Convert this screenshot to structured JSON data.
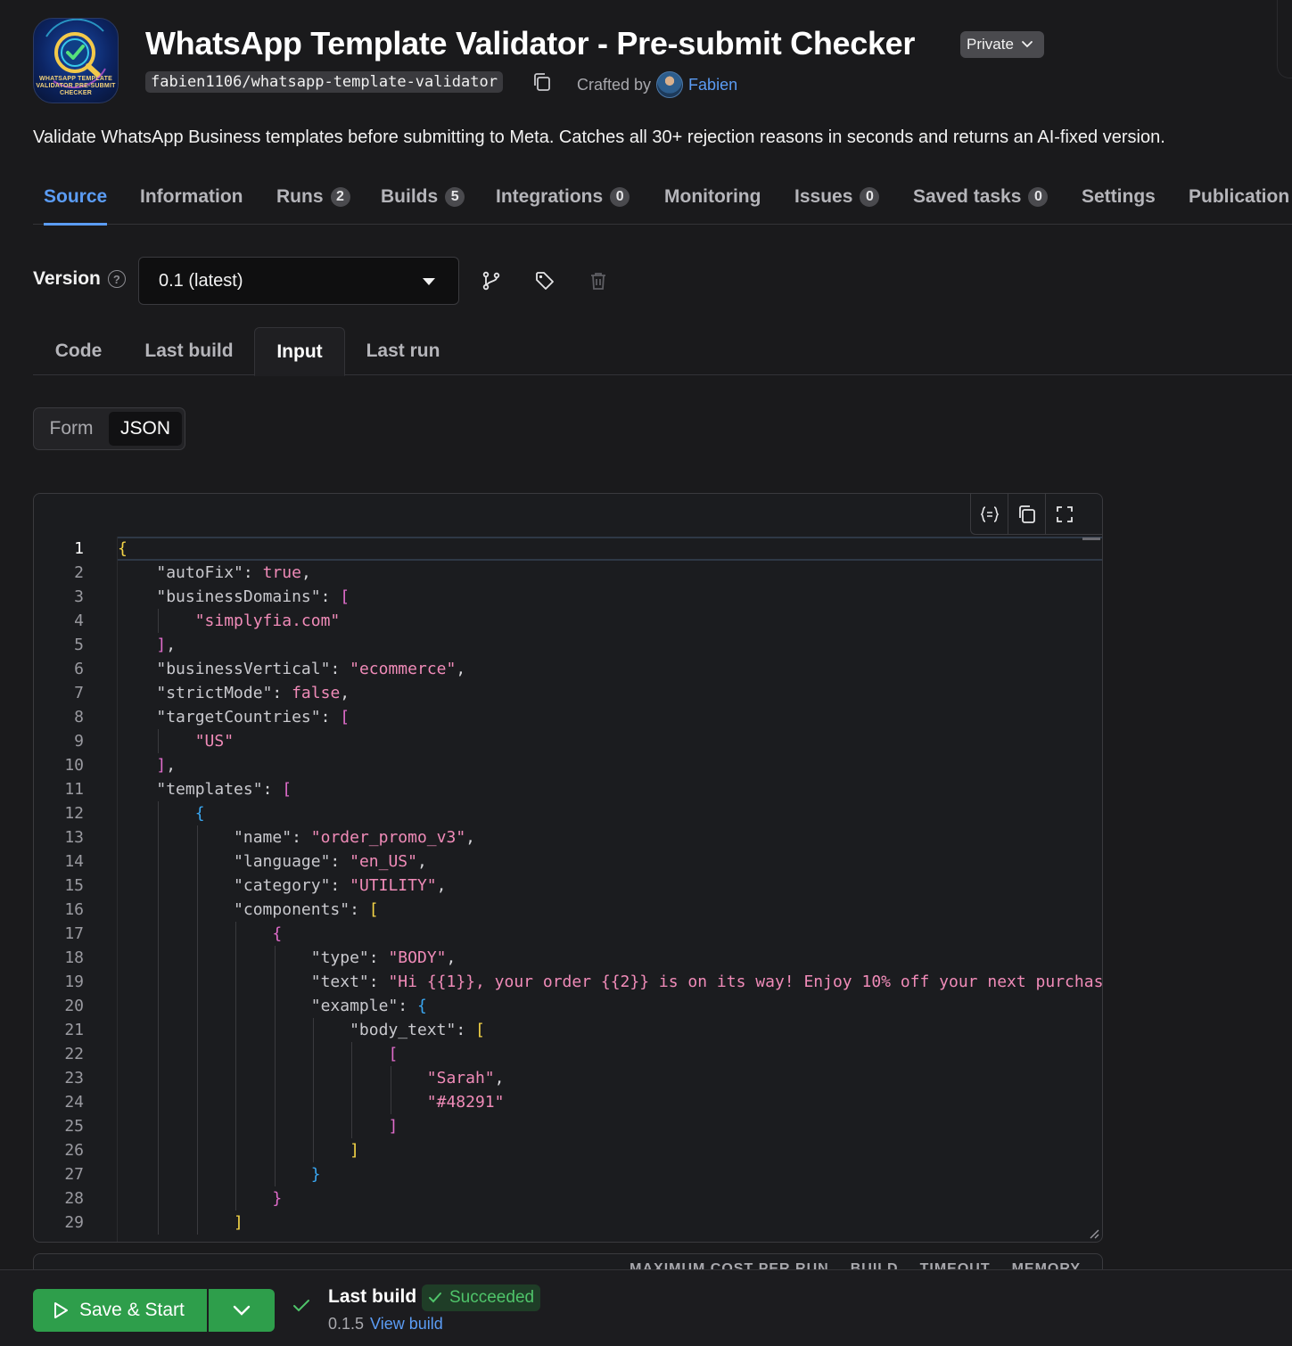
{
  "actor": {
    "logo_text": "WHATSAPP TEMPLATE VALIDATOR PRE-SUBMIT CHECKER",
    "title": "WhatsApp Template Validator - Pre-submit Checker",
    "visibility": "Private",
    "slug": "fabien1106/whatsapp-template-validator",
    "crafted_by_label": "Crafted by",
    "author": "Fabien",
    "description": "Validate WhatsApp Business templates before submitting to Meta. Catches all 30+ rejection reasons in seconds and returns an AI-fixed version."
  },
  "tabs": [
    {
      "label": "Source",
      "count": null
    },
    {
      "label": "Information",
      "count": null
    },
    {
      "label": "Runs",
      "count": "2"
    },
    {
      "label": "Builds",
      "count": "5"
    },
    {
      "label": "Integrations",
      "count": "0"
    },
    {
      "label": "Monitoring",
      "count": null
    },
    {
      "label": "Issues",
      "count": "0"
    },
    {
      "label": "Saved tasks",
      "count": "0"
    },
    {
      "label": "Settings",
      "count": null
    },
    {
      "label": "Publication",
      "count": null
    }
  ],
  "active_tab": "Source",
  "version": {
    "label": "Version",
    "help_icon": "?",
    "selected": "0.1 (latest)"
  },
  "subtabs": [
    "Code",
    "Last build",
    "Input",
    "Last run"
  ],
  "active_subtab": "Input",
  "input_mode": {
    "options": [
      "Form",
      "JSON"
    ],
    "selected": "JSON"
  },
  "editor": {
    "line_numbers": [
      "1",
      "2",
      "3",
      "4",
      "5",
      "6",
      "7",
      "8",
      "9",
      "10",
      "11",
      "12",
      "13",
      "14",
      "15",
      "16",
      "17",
      "18",
      "19",
      "20",
      "21",
      "22",
      "23",
      "24",
      "25",
      "26",
      "27",
      "28",
      "29"
    ],
    "lines": [
      [
        [
          "{",
          "b1"
        ]
      ],
      [
        [
          "    ",
          ""
        ],
        [
          "\"autoFix\"",
          "k"
        ],
        [
          ": ",
          ""
        ],
        [
          "true",
          "lit"
        ],
        [
          ",",
          ""
        ]
      ],
      [
        [
          "    ",
          ""
        ],
        [
          "\"businessDomains\"",
          "k"
        ],
        [
          ": ",
          ""
        ],
        [
          "[",
          "b2"
        ]
      ],
      [
        [
          "        ",
          ""
        ],
        [
          "\"simplyfia.com\"",
          "s"
        ]
      ],
      [
        [
          "    ",
          ""
        ],
        [
          "]",
          "b2"
        ],
        [
          ",",
          ""
        ]
      ],
      [
        [
          "    ",
          ""
        ],
        [
          "\"businessVertical\"",
          "k"
        ],
        [
          ": ",
          ""
        ],
        [
          "\"ecommerce\"",
          "s"
        ],
        [
          ",",
          ""
        ]
      ],
      [
        [
          "    ",
          ""
        ],
        [
          "\"strictMode\"",
          "k"
        ],
        [
          ": ",
          ""
        ],
        [
          "false",
          "lit"
        ],
        [
          ",",
          ""
        ]
      ],
      [
        [
          "    ",
          ""
        ],
        [
          "\"targetCountries\"",
          "k"
        ],
        [
          ": ",
          ""
        ],
        [
          "[",
          "b2"
        ]
      ],
      [
        [
          "        ",
          ""
        ],
        [
          "\"US\"",
          "s"
        ]
      ],
      [
        [
          "    ",
          ""
        ],
        [
          "]",
          "b2"
        ],
        [
          ",",
          ""
        ]
      ],
      [
        [
          "    ",
          ""
        ],
        [
          "\"templates\"",
          "k"
        ],
        [
          ": ",
          ""
        ],
        [
          "[",
          "b2"
        ]
      ],
      [
        [
          "        ",
          ""
        ],
        [
          "{",
          "b3"
        ]
      ],
      [
        [
          "            ",
          ""
        ],
        [
          "\"name\"",
          "k"
        ],
        [
          ": ",
          ""
        ],
        [
          "\"order_promo_v3\"",
          "s"
        ],
        [
          ",",
          ""
        ]
      ],
      [
        [
          "            ",
          ""
        ],
        [
          "\"language\"",
          "k"
        ],
        [
          ": ",
          ""
        ],
        [
          "\"en_US\"",
          "s"
        ],
        [
          ",",
          ""
        ]
      ],
      [
        [
          "            ",
          ""
        ],
        [
          "\"category\"",
          "k"
        ],
        [
          ": ",
          ""
        ],
        [
          "\"UTILITY\"",
          "s"
        ],
        [
          ",",
          ""
        ]
      ],
      [
        [
          "            ",
          ""
        ],
        [
          "\"components\"",
          "k"
        ],
        [
          ": ",
          ""
        ],
        [
          "[",
          "b1"
        ]
      ],
      [
        [
          "                ",
          ""
        ],
        [
          "{",
          "b2"
        ]
      ],
      [
        [
          "                    ",
          ""
        ],
        [
          "\"type\"",
          "k"
        ],
        [
          ": ",
          ""
        ],
        [
          "\"BODY\"",
          "s"
        ],
        [
          ",",
          ""
        ]
      ],
      [
        [
          "                    ",
          ""
        ],
        [
          "\"text\"",
          "k"
        ],
        [
          ": ",
          ""
        ],
        [
          "\"Hi {{1}}, your order {{2}} is on its way! Enjoy 10% off your next purchas",
          "s"
        ]
      ],
      [
        [
          "                    ",
          ""
        ],
        [
          "\"example\"",
          "k"
        ],
        [
          ": ",
          ""
        ],
        [
          "{",
          "b3"
        ]
      ],
      [
        [
          "                        ",
          ""
        ],
        [
          "\"body_text\"",
          "k"
        ],
        [
          ": ",
          ""
        ],
        [
          "[",
          "b1"
        ]
      ],
      [
        [
          "                            ",
          ""
        ],
        [
          "[",
          "b2"
        ]
      ],
      [
        [
          "                                ",
          ""
        ],
        [
          "\"Sarah\"",
          "s"
        ],
        [
          ",",
          ""
        ]
      ],
      [
        [
          "                                ",
          ""
        ],
        [
          "\"#48291\"",
          "s"
        ]
      ],
      [
        [
          "                            ",
          ""
        ],
        [
          "]",
          "b2"
        ]
      ],
      [
        [
          "                        ",
          ""
        ],
        [
          "]",
          "b1"
        ]
      ],
      [
        [
          "                    ",
          ""
        ],
        [
          "}",
          "b3"
        ]
      ],
      [
        [
          "                ",
          ""
        ],
        [
          "}",
          "b2"
        ]
      ],
      [
        [
          "            ",
          ""
        ],
        [
          "]",
          "b1"
        ]
      ]
    ]
  },
  "settings_peek": {
    "labels": [
      "MAXIMUM COST PER RUN",
      "BUILD",
      "TIMEOUT",
      "MEMORY"
    ]
  },
  "bottom_bar": {
    "save_label": "Save & Start",
    "last_build_label": "Last build",
    "status": "Succeeded",
    "build_version": "0.1.5",
    "view_build_label": "View build"
  },
  "colors": {
    "accent": "#5b9cf4",
    "success": "#2e9e4b",
    "background": "#1a1a1c"
  }
}
